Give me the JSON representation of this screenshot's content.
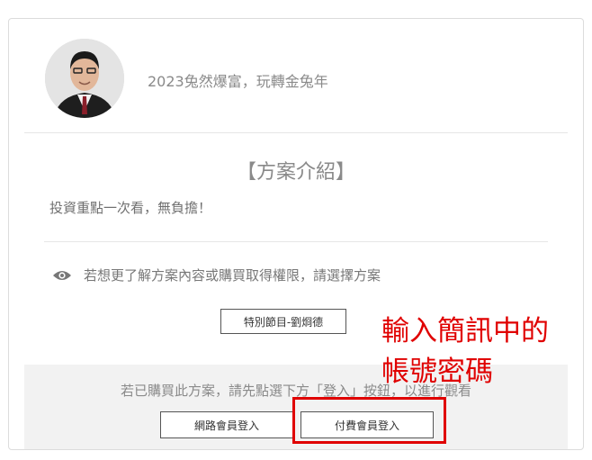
{
  "profile": {
    "title": "2023兔然爆富，玩轉金兔年"
  },
  "plan": {
    "heading": "【方案介紹】",
    "description": "投資重點一次看，無負擔！",
    "notice": "若想更了解方案內容或購買取得權限，請選擇方案",
    "program_button": "特別節目-劉烱德"
  },
  "footer": {
    "text": "若已購買此方案，請先點選下方「登入」按鈕，以進行觀看",
    "online_login": "網路會員登入",
    "paid_login": "付費會員登入"
  },
  "annotation": {
    "line1": "輸入簡訊中的",
    "line2": "帳號密碼",
    "color": "#e00000"
  }
}
